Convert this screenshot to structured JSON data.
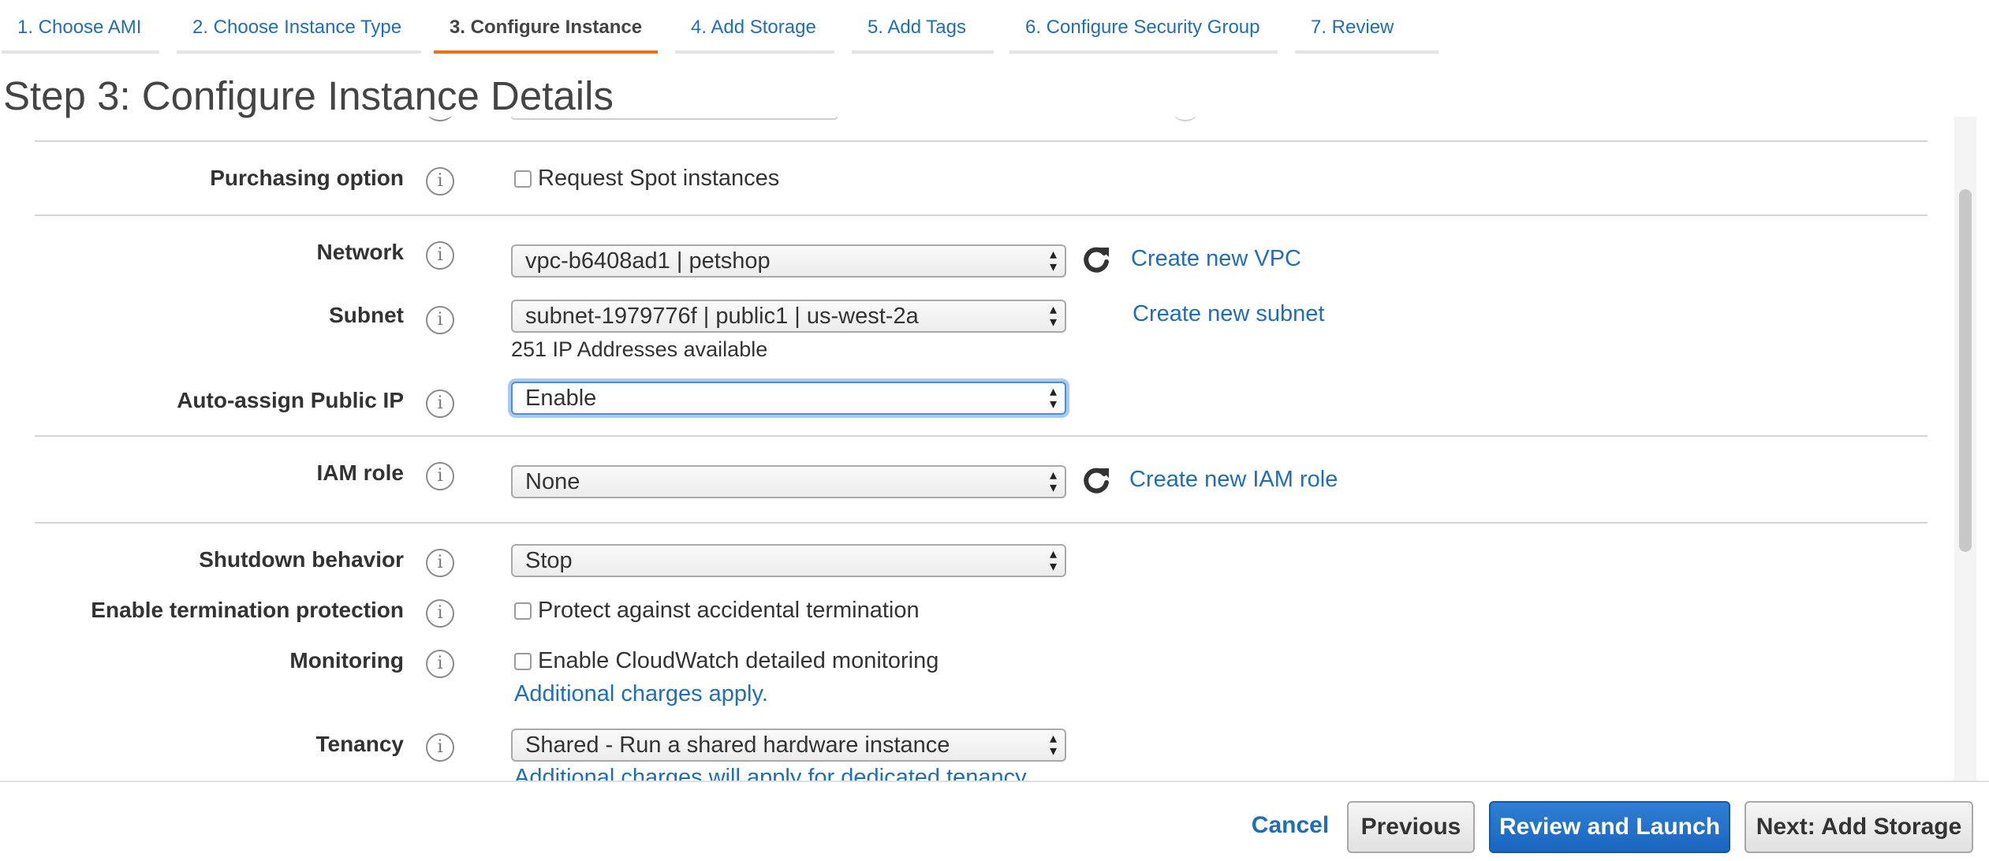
{
  "wizard": {
    "tabs": [
      {
        "label": "1. Choose AMI"
      },
      {
        "label": "2. Choose Instance Type"
      },
      {
        "label": "3. Configure Instance"
      },
      {
        "label": "4. Add Storage"
      },
      {
        "label": "5. Add Tags"
      },
      {
        "label": "6. Configure Security Group"
      },
      {
        "label": "7. Review"
      }
    ],
    "active_tab_index": 2
  },
  "page": {
    "title": "Step 3: Configure Instance Details"
  },
  "form": {
    "info_glyph": "i",
    "purchasing": {
      "label": "Purchasing option",
      "checkbox_label": "Request Spot instances",
      "checked": false
    },
    "network": {
      "label": "Network",
      "value": "vpc-b6408ad1 | petshop",
      "link": "Create new VPC"
    },
    "subnet": {
      "label": "Subnet",
      "value": "subnet-1979776f | public1 | us-west-2a",
      "link": "Create new subnet",
      "note": "251 IP Addresses available"
    },
    "auto_ip": {
      "label": "Auto-assign Public IP",
      "value": "Enable"
    },
    "iam": {
      "label": "IAM role",
      "value": "None",
      "link": "Create new IAM role"
    },
    "shutdown": {
      "label": "Shutdown behavior",
      "value": "Stop"
    },
    "termination": {
      "label": "Enable termination protection",
      "checkbox_label": "Protect against accidental termination",
      "checked": false
    },
    "monitoring": {
      "label": "Monitoring",
      "checkbox_label": "Enable CloudWatch detailed monitoring",
      "checked": false,
      "link": "Additional charges apply."
    },
    "tenancy": {
      "label": "Tenancy",
      "value": "Shared - Run a shared hardware instance",
      "link": "Additional charges will apply for dedicated tenancy."
    }
  },
  "footer": {
    "cancel": "Cancel",
    "previous": "Previous",
    "review_launch": "Review and Launch",
    "next": "Next: Add Storage"
  },
  "colors": {
    "link": "#1f6eb8",
    "active_tab": "#ec7211",
    "primary": "#1a66bf"
  },
  "icons": [
    "info-icon",
    "refresh-icon",
    "select-arrows-icon",
    "checkbox-icon"
  ]
}
